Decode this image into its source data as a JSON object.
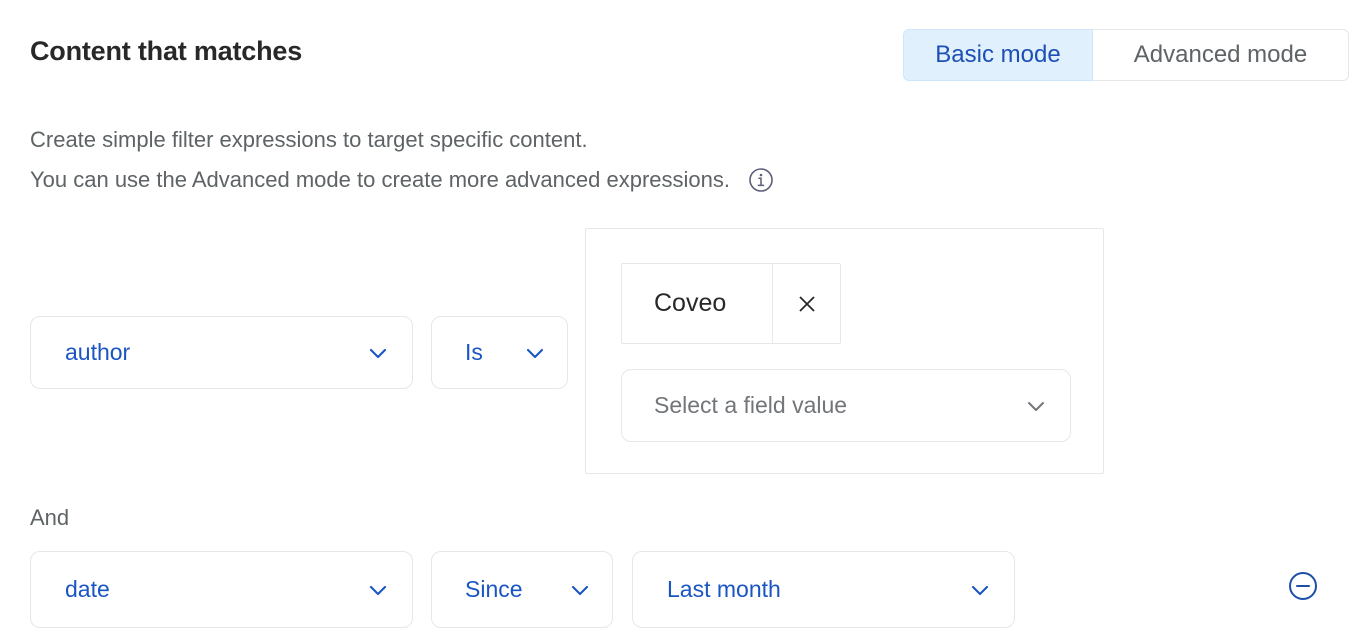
{
  "header": {
    "title": "Content that matches"
  },
  "mode_toggle": {
    "basic_label": "Basic mode",
    "advanced_label": "Advanced mode",
    "selected": "Basic mode",
    "active_bg": "#e0f0fd",
    "active_text": "#1d4fb4",
    "inactive_text": "#5e6366"
  },
  "description": {
    "line1": "Create simple filter expressions to target specific content.",
    "line2": "You can use the Advanced mode to create more advanced expressions.",
    "info_icon": "info-icon"
  },
  "filters": [
    {
      "field": {
        "value": "author",
        "icon": "chevron-down-icon"
      },
      "operator": {
        "value": "Is",
        "icon": "chevron-down-icon"
      },
      "values": {
        "chips": [
          {
            "label": "Coveo",
            "remove_icon": "close-icon"
          }
        ],
        "select_placeholder": "Select a field value",
        "select_icon": "chevron-down-icon"
      },
      "remove_icon": "minus-circle-icon"
    },
    {
      "conjunction": "And",
      "field": {
        "value": "date",
        "icon": "chevron-down-icon"
      },
      "operator": {
        "value": "Since",
        "icon": "chevron-down-icon"
      },
      "value": {
        "value": "Last month",
        "icon": "chevron-down-icon"
      }
    }
  ],
  "colors": {
    "accent_blue": "#1a55c4",
    "border_gray": "#e5e8e8",
    "text_gray": "#5e6366",
    "placeholder_gray": "#72767a",
    "title_dark": "#282829"
  }
}
